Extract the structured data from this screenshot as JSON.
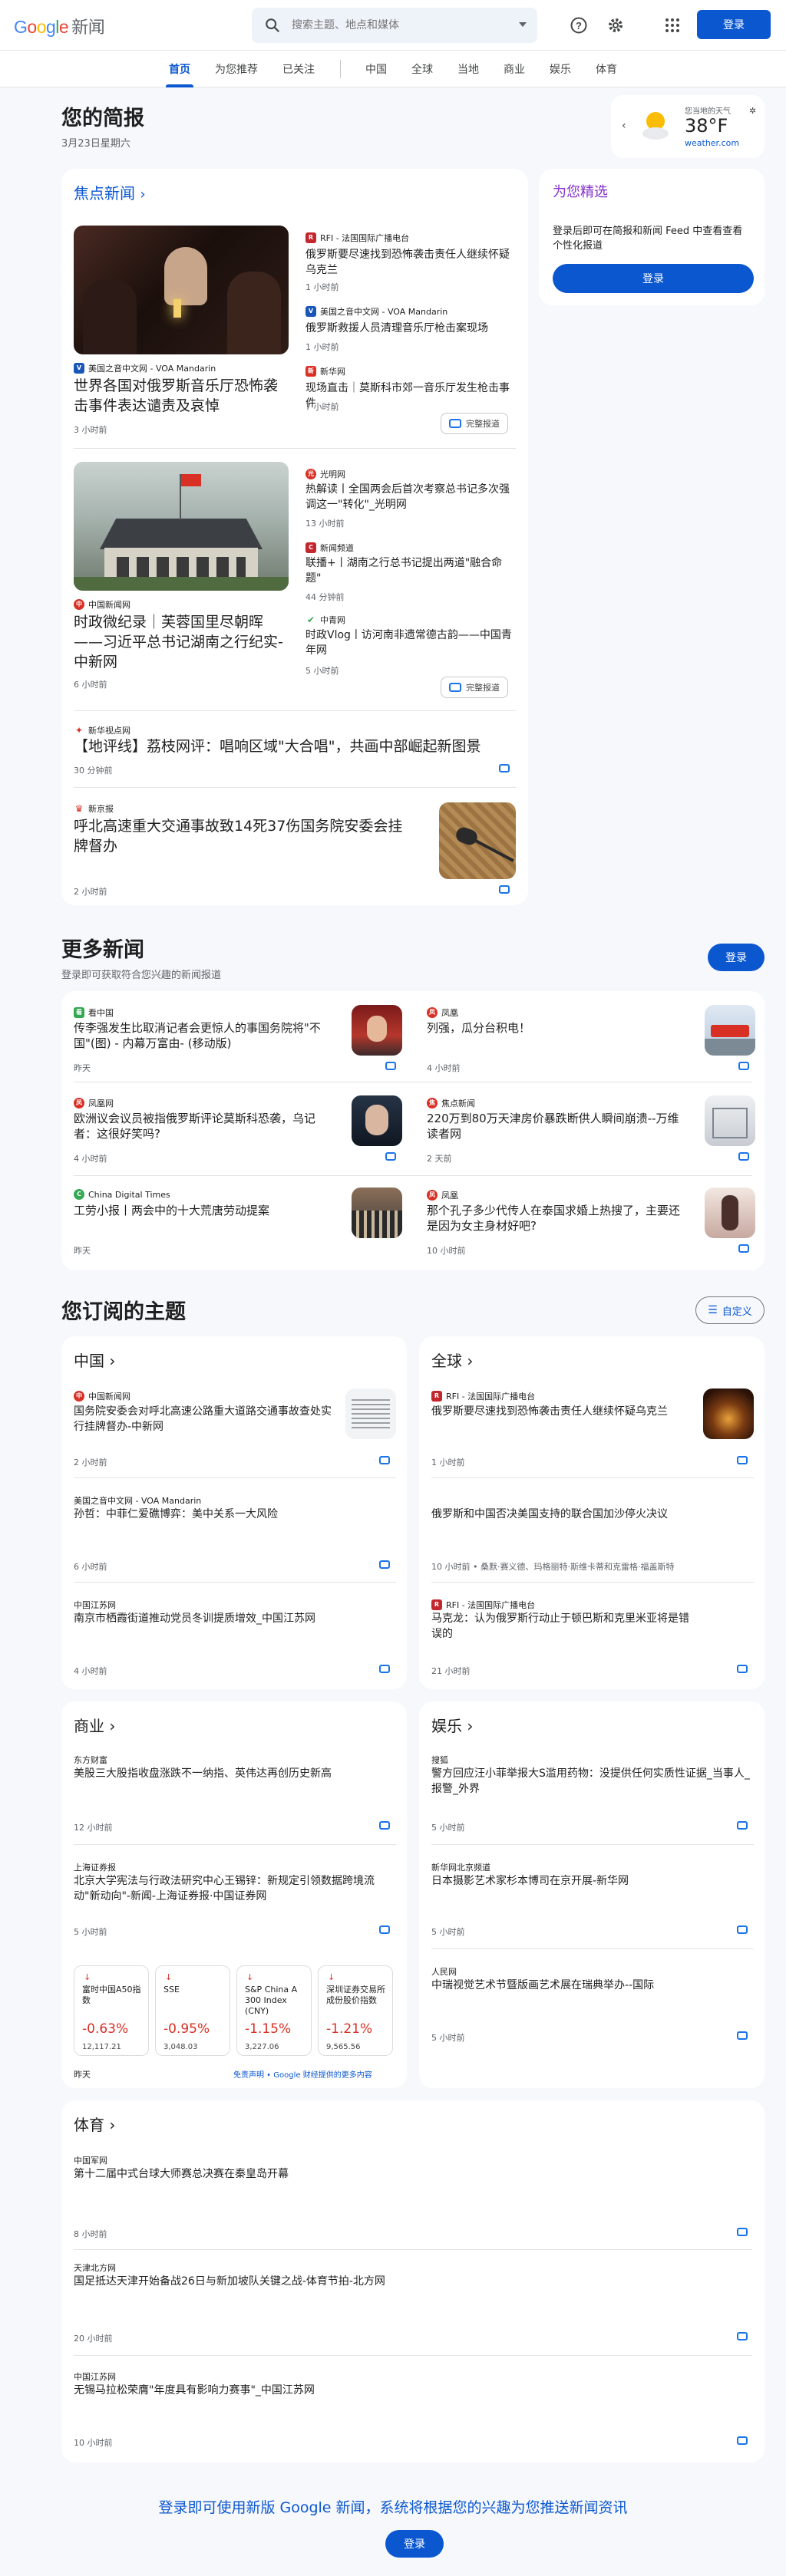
{
  "header": {
    "logo_google": [
      "G",
      "o",
      "o",
      "g",
      "l",
      "e"
    ],
    "logo_news": "新闻",
    "search_placeholder": "搜索主题、地点和媒体",
    "signin": "登录"
  },
  "nav": {
    "tabs": [
      "首页",
      "为您推荐",
      "已关注",
      "中国",
      "全球",
      "当地",
      "商业",
      "娱乐",
      "体育"
    ],
    "active": "首页"
  },
  "briefing": {
    "title": "您的简报",
    "date": "3月23日星期六",
    "weather": {
      "label": "您当地的天气",
      "temp": "38°F",
      "source": "weather.com"
    }
  },
  "top_news": {
    "heading": "焦点新闻",
    "clusters": [
      {
        "main": {
          "source": "美国之音中文网 - VOA Mandarin",
          "title": "世界各国对俄罗斯音乐厅恐怖袭击事件表达谴责及哀悼",
          "time": "3 小时前"
        },
        "side": [
          {
            "source": "RFI - 法国国际广播电台",
            "title": "俄罗斯要尽速找到恐怖袭击责任人继续怀疑乌克兰",
            "time": "1 小时前"
          },
          {
            "source": "美国之音中文网 - VOA Mandarin",
            "title": "俄罗斯救援人员清理音乐厅枪击案现场",
            "time": "1 小时前"
          },
          {
            "source": "新华网",
            "title": "现场直击｜莫斯科市郊一音乐厅发生枪击事件",
            "time": "7 小时前"
          }
        ],
        "full": "完整报道"
      },
      {
        "main": {
          "source": "中国新闻网",
          "title": "时政微纪录｜芙蓉国里尽朝晖——习近平总书记湖南之行纪实-中新网",
          "time": "6 小时前"
        },
        "side": [
          {
            "source": "光明网",
            "title": "热解读丨全国两会后首次考察总书记多次强调这一\"转化\"_光明网",
            "time": "13 小时前"
          },
          {
            "source": "新闻频道",
            "title": "联播+丨湖南之行总书记提出两道\"融合命题\"",
            "time": "44 分钟前"
          },
          {
            "source": "中青网",
            "title": "时政Vlog丨访河南非遗常德古韵——中国青年网",
            "time": "5 小时前"
          }
        ],
        "full": "完整报道"
      }
    ],
    "singles": [
      {
        "source": "新华视点网",
        "title": "【地评线】荔枝网评：唱响区域\"大合唱\"，共画中部崛起新图景",
        "time": "30 分钟前"
      },
      {
        "source": "新京报",
        "title": "呼北高速重大交通事故致14死37伤国务院安委会挂牌督办",
        "time": "2 小时前"
      }
    ]
  },
  "picks": {
    "title": "为您精选",
    "desc": "登录后即可在简报和新闻 Feed 中查看查看个性化报道",
    "button": "登录"
  },
  "more": {
    "title": "更多新闻",
    "subtitle": "登录即可获取符合您兴趣的新闻报道",
    "button": "登录",
    "items": [
      {
        "source": "看中国",
        "title": "传李强发生比取消记者会更惊人的事国务院将\"不国\"(图) - 内幕万富由- (移动版)",
        "time": "昨天"
      },
      {
        "source": "凤凰",
        "title": "列强，瓜分台积电！",
        "time": "4 小时前"
      },
      {
        "source": "凤凰网",
        "title": "欧洲议会议员被指俄罗斯评论莫斯科恐袭，乌记者：这很好笑吗?",
        "time": "4 小时前"
      },
      {
        "source": "焦点新闻",
        "title": "220万到80万天津房价暴跌断供人瞬间崩溃--万维读者网",
        "time": "2 天前"
      },
      {
        "source": "China Digital Times",
        "title": "工劳小报丨两会中的十大荒唐劳动提案",
        "time": "昨天"
      },
      {
        "source": "凤凰",
        "title": "那个孔子多少代传人在泰国求婚上热搜了，主要还是因为女主身材好吧?",
        "time": "10 小时前"
      }
    ]
  },
  "topics": {
    "title": "您订阅的主题",
    "customize": "自定义",
    "china": {
      "heading": "中国",
      "items": [
        {
          "source": "中国新闻网",
          "title": "国务院安委会对呼北高速公路重大道路交通事故查处实行挂牌督办-中新网",
          "time": "2 小时前"
        },
        {
          "source": "美国之音中文网 - VOA Mandarin",
          "title": "孙哲：中菲仁爱礁博弈：美中关系一大风险",
          "time": "6 小时前"
        },
        {
          "source": "中国江苏网",
          "title": "南京市栖霞街道推动党员冬训提质增效_中国江苏网",
          "time": "4 小时前"
        }
      ]
    },
    "world": {
      "heading": "全球",
      "items": [
        {
          "source": "RFI - 法国国际广播电台",
          "title": "俄罗斯要尽速找到恐怖袭击责任人继续怀疑乌克兰",
          "time": "1 小时前"
        },
        {
          "source": "",
          "title": "俄罗斯和中国否决美国支持的联合国加沙停火决议",
          "time": "10 小时前 • 桑默·赛义德、玛格丽特·斯维卡蒂和克雷格·福盖斯特"
        },
        {
          "source": "RFI - 法国国际广播电台",
          "title": "马克龙：认为俄罗斯行动止于顿巴斯和克里米亚将是错误的",
          "time": "21 小时前"
        }
      ]
    },
    "business": {
      "heading": "商业",
      "items": [
        {
          "source": "东方财富",
          "title": "美股三大股指收盘涨跌不一纳指、英伟达再创历史新高",
          "time": "12 小时前"
        },
        {
          "source": "上海证券报",
          "title": "北京大学宪法与行政法研究中心王锡锌：新规定引领数据跨境流动\"新动向\"-新闻-上海证券报·中国证券网",
          "time": "5 小时前"
        }
      ],
      "stocks": [
        {
          "name": "富时中国A50指数",
          "pct": "-0.63%",
          "value": "12,117.21"
        },
        {
          "name": "SSE",
          "pct": "-0.95%",
          "value": "3,048.03"
        },
        {
          "name": "S&P China A 300 Index (CNY)",
          "pct": "-1.15%",
          "value": "3,227.06"
        },
        {
          "name": "深圳证券交易所成份股价指数",
          "pct": "-1.21%",
          "value": "9,565.56"
        }
      ],
      "stocks_time": "昨天",
      "disclaimer": "免责声明 • Google 财经提供的更多内容"
    },
    "ent": {
      "heading": "娱乐",
      "items": [
        {
          "source": "搜狐",
          "title": "警方回应汪小菲举报大S滥用药物：没提供任何实质性证据_当事人_报警_外界",
          "time": "5 小时前"
        },
        {
          "source": "新华网北京频道",
          "title": "日本摄影艺术家杉本博司在京开展-新华网",
          "time": "5 小时前"
        },
        {
          "source": "人民网",
          "title": "中瑞视觉艺术节暨版画艺术展在瑞典举办--国际",
          "time": "5 小时前"
        }
      ]
    },
    "sports": {
      "heading": "体育",
      "items": [
        {
          "source": "中国军网",
          "title": "第十二届中式台球大师赛总决赛在秦皇岛开幕",
          "time": "8 小时前"
        },
        {
          "source": "天津北方网",
          "title": "国足抵达天津开始备战26日与新加坡队关键之战-体育节拍-北方网",
          "time": "20 小时前"
        },
        {
          "source": "中国江苏网",
          "title": "无锡马拉松荣膺\"年度具有影响力赛事\"_中国江苏网",
          "time": "10 小时前"
        }
      ]
    }
  },
  "footer": {
    "cta": "登录即可使用新版 Google 新闻，系统将根据您的兴趣为您推送新闻资讯",
    "button": "登录"
  }
}
